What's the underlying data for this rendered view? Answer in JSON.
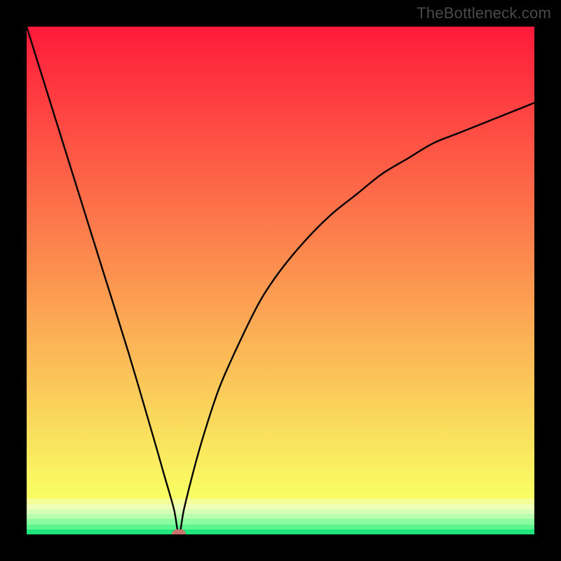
{
  "watermark": {
    "text": "TheBottleneck.com"
  },
  "colors": {
    "frame_bg": "#000000",
    "marker_fill": "#c9736e",
    "curve_stroke": "#000000"
  },
  "chart_data": {
    "type": "line",
    "title": "",
    "xlabel": "",
    "ylabel": "",
    "xlim": [
      0,
      100
    ],
    "ylim": [
      0,
      100
    ],
    "series": [
      {
        "name": "bottleneck-curve",
        "x": [
          0,
          5,
          10,
          15,
          20,
          25,
          27,
          29,
          30,
          31,
          33,
          35,
          38,
          42,
          46,
          50,
          55,
          60,
          65,
          70,
          75,
          80,
          85,
          90,
          95,
          100
        ],
        "y": [
          100,
          84,
          68,
          52,
          36,
          19,
          12,
          5,
          0,
          5,
          13,
          20,
          29,
          38,
          46,
          52,
          58,
          63,
          67,
          71,
          74,
          77,
          79,
          81,
          83,
          85
        ]
      }
    ],
    "marker": {
      "x": 30,
      "y": 0
    },
    "gradient_bands": [
      {
        "from": 0,
        "to": 93,
        "type": "smooth",
        "top_color": "#ff1a3a",
        "bottom_color": "#f9ff63"
      },
      {
        "from": 93,
        "to": 94,
        "color": "#f5ff9a"
      },
      {
        "from": 94,
        "to": 95,
        "color": "#f0ffb8"
      },
      {
        "from": 95,
        "to": 96,
        "color": "#d8ffb8"
      },
      {
        "from": 96,
        "to": 97,
        "color": "#b8ffb0"
      },
      {
        "from": 97,
        "to": 98,
        "color": "#8cfca0"
      },
      {
        "from": 98,
        "to": 99,
        "color": "#5cf590"
      },
      {
        "from": 99,
        "to": 100,
        "color": "#1fe67a"
      }
    ]
  }
}
